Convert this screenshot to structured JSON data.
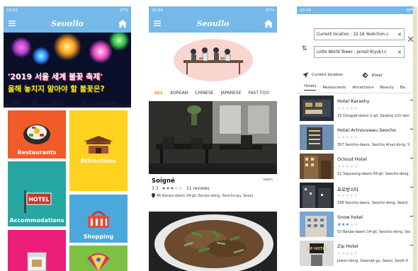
{
  "colors": {
    "appbar": "#74b9e8",
    "accent": "#f7931e",
    "restaurants": "#f15a29",
    "attractions": "#ffd21f",
    "hotel": "#26a7a3",
    "shopping": "#4aa8dd",
    "cat5": "#ec1e79",
    "cat6": "#7dc142"
  },
  "phone1": {
    "status": {
      "time": "22:02",
      "battery": "37%"
    },
    "app_title": "Seoullo",
    "banner": {
      "line1": "'2019 서울 세계 불꽃 축제'",
      "line2": "올해 놓치지 말아야 할 불꽃은?"
    },
    "categories": [
      "Restaurants",
      "Attractions",
      "Accommodations",
      "Shopping"
    ],
    "hotel_sign": "HOTEL"
  },
  "phone2": {
    "status": {
      "time": "22:09",
      "battery": "37%"
    },
    "app_title": "Seoullo",
    "tabs": [
      "ALL",
      "KOREAN",
      "CHINESE",
      "JAPANESE",
      "FAST FOO"
    ],
    "restaurant": {
      "name": "Soigné",
      "rating": "3.3",
      "stars": 3.3,
      "reviews": "11 reviews",
      "address": "46 Banpo-daero 39-gil, Banpo-dong, Seocho-gu, Seoul",
      "status": "open"
    }
  },
  "phone3": {
    "status": {
      "time": "23:09",
      "battery": "38%"
    },
    "current_location": "Current location : 32-16 Yeokchon-c",
    "destination": "Lotte World Tower : Jamsil 6(yuk)-c",
    "actions": [
      "Current location",
      "Enter"
    ],
    "tabs": [
      "Hotels",
      "Restaurants",
      "Attractions",
      "Beauty",
      "Ba"
    ],
    "hotels": [
      {
        "name": "Hotel Karashy",
        "address": "15 Dongjak-daero 1-gil, Sadang 1(il)-don",
        "stars": 0
      },
      {
        "name": "Hotel Artnouveau Seocho",
        "address": "357 Seocho-daero, Seocho 4(sa)-dong, S",
        "stars": 0
      },
      {
        "name": "Ocloud Hotel",
        "address": "12 Sapyeong-daero 58-gil, Seocho-dong,",
        "stars": 0
      },
      {
        "name": "프로방스타",
        "address": "338 Seocho-daero, Seocho-dong, Seoch",
        "stars": 0
      },
      {
        "name": "Snow hotel",
        "address": "53 Banpo-daero 14-gil, Seocho-dong, Sec",
        "stars": 3
      },
      {
        "name": "Zip Hotel",
        "address": "Jowon-dong, Gwanak-gu, Seoul, South K",
        "stars": 0
      }
    ],
    "zip_sign": "ZIP HOTEL"
  }
}
